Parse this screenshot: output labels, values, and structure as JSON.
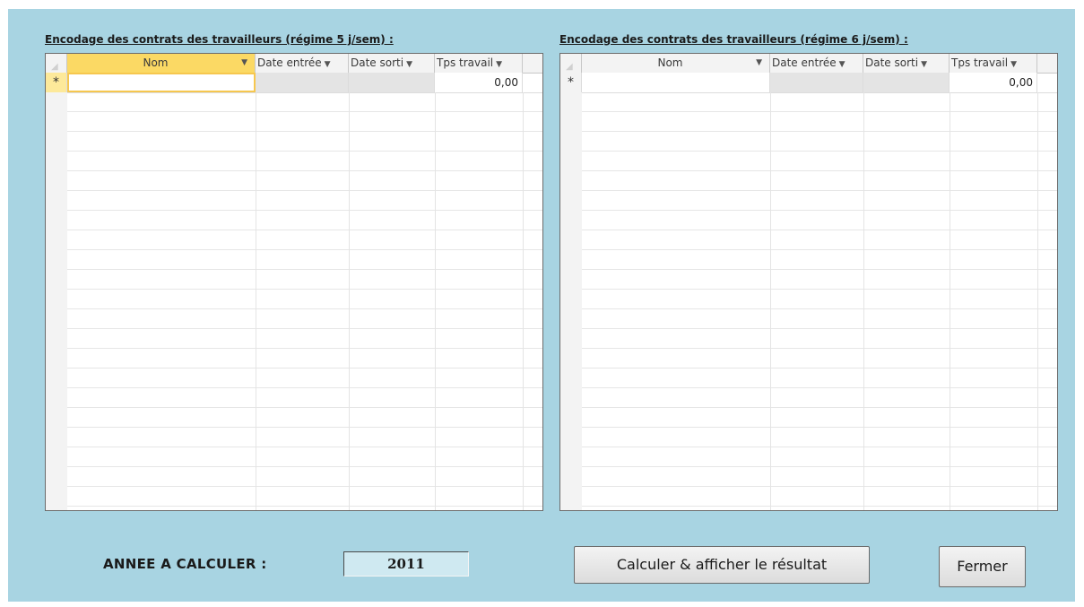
{
  "grids": {
    "left": {
      "caption": "Encodage des contrats des travailleurs (régime 5 j/sem) :",
      "columns": [
        "Nom",
        "Date entrée",
        "Date sorti",
        "Tps travail"
      ],
      "new_row": {
        "marker": "*",
        "nom": "",
        "date_entree": "",
        "date_sortie": "",
        "tps_travail": "0,00"
      }
    },
    "right": {
      "caption": "Encodage des contrats des travailleurs (régime 6 j/sem) :",
      "columns": [
        "Nom",
        "Date entrée",
        "Date sorti",
        "Tps travail"
      ],
      "new_row": {
        "marker": "*",
        "nom": "",
        "date_entree": "",
        "date_sortie": "",
        "tps_travail": "0,00"
      }
    }
  },
  "year": {
    "label": "ANNEE A CALCULER :",
    "value": "2011"
  },
  "buttons": {
    "calculate": "Calculer & afficher le résultat",
    "close": "Fermer"
  },
  "colors": {
    "form_background": "#a8d4e2",
    "active_header": "#fbd964"
  }
}
